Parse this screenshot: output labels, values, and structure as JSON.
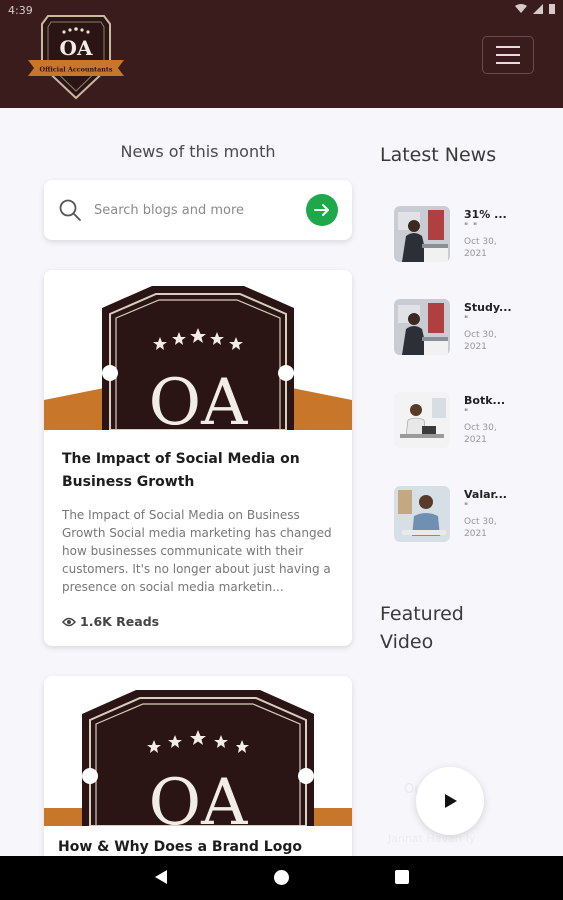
{
  "status_bar": {
    "time": "4:39"
  },
  "header": {
    "logo_text": "OA",
    "logo_ribbon": "Official Accountants"
  },
  "main": {
    "section_title": "News of this month",
    "search": {
      "placeholder": "Search blogs and more"
    },
    "posts": [
      {
        "image_text": "OA",
        "title": "The Impact of Social Media on Business Growth",
        "excerpt": "The Impact of Social Media on Business Growth  Social media marketing has changed how businesses communicate with their customers. It's no longer about just having a presence on social media marketin...",
        "reads": "1.6K Reads"
      },
      {
        "image_text": "OA",
        "title": "How & Why Does a Brand Logo"
      }
    ]
  },
  "sidebar": {
    "latest_title": "Latest News",
    "items": [
      {
        "title": "31% ...",
        "dash": "\" \"",
        "date": "Oct 30, 2021"
      },
      {
        "title": "Study...",
        "dash": "\"",
        "date": "Oct 30, 2021"
      },
      {
        "title": "Botk...",
        "dash": "\"",
        "date": "Oct 30, 2021"
      },
      {
        "title": "Valar...",
        "dash": "\"",
        "date": "Oct 30, 2021"
      }
    ],
    "featured_title": "Featured Video",
    "video_caption": "Our",
    "video_subcaption": "Jannat Haveri ly"
  },
  "colors": {
    "header_bg": "#3a1c1c",
    "accent_green": "#1fa84a",
    "logo_orange": "#c8772a"
  }
}
